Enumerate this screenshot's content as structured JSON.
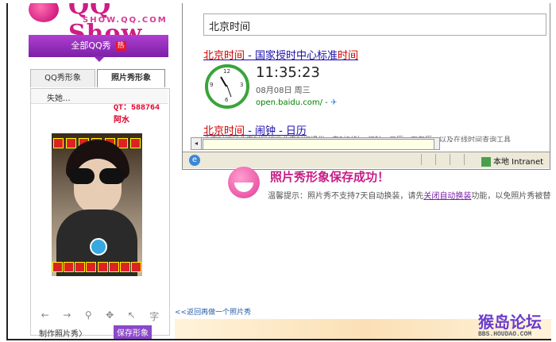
{
  "brand": {
    "title": "QQ Show",
    "domain": "SHOW.QQ.COM"
  },
  "left": {
    "all_label": "全部QQ秀",
    "hot_badge": "热",
    "tabs": [
      "QQ秀形象",
      "照片秀形象"
    ],
    "select_text": "失她...",
    "qt_text": "QT：588764  阿水",
    "bottom_left": "制作照片秀〉",
    "bottom_right": "保存形象"
  },
  "browser": {
    "search_value": "北京时间",
    "result1": {
      "title_a": "北京时间",
      "title_b": " - 国家授时中心标准",
      "title_c": "时间"
    },
    "clock_numbers": [
      "12",
      "3",
      "6",
      "9"
    ],
    "time": "11:35:23",
    "date": "08月08日  周三",
    "url": "open.baidu.com/ - ",
    "result2": {
      "title_a": "北京时间",
      "title_b": " - 闹钟 - 日历"
    },
    "result2_snippet": "北京时间是北京时区标准北京时间提供，实时时钟，闹钟，日历，万年历，以及在线时间查询工具",
    "status_zone": "本地 Intranet"
  },
  "success": {
    "title": "照片秀形象保存成功！",
    "notice_before": "温馨提示：照片秀不支持7天自动换装，请先",
    "notice_link": "关闭自动换装",
    "notice_after": "功能，以免照片秀被替换"
  },
  "back_link": "<<返回再做一个照片秀",
  "watermark": {
    "title": "猴岛论坛",
    "sub": "BBS.HOUDAO.COM"
  }
}
